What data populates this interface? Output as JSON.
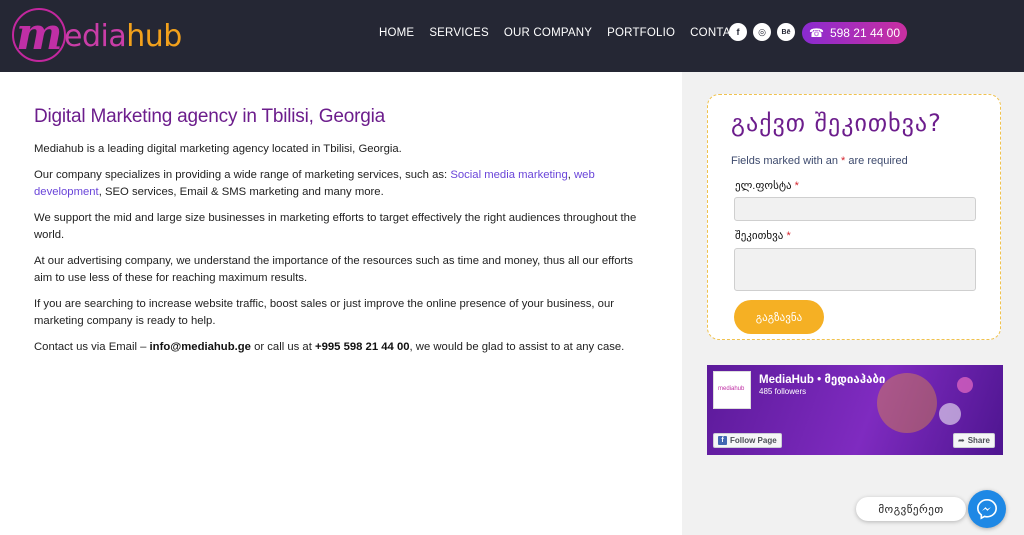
{
  "logo": {
    "m": "m",
    "media": "edia",
    "hub": "hub"
  },
  "nav": {
    "items": [
      "HOME",
      "SERVICES",
      "OUR COMPANY",
      "PORTFOLIO",
      "CONTACT"
    ]
  },
  "social": {
    "facebook": "f",
    "instagram": "◎",
    "behance": "Bē"
  },
  "phone_button": {
    "icon": "☎",
    "number": "598 21 44 00"
  },
  "main": {
    "title": "Digital Marketing agency in Tbilisi, Georgia",
    "p1": "Mediahub is a leading digital marketing agency located in Tbilisi, Georgia.",
    "p2_a": "Our company specializes in providing a wide range of marketing services, such as: ",
    "p2_link1": "Social media marketing",
    "p2_comma": ", ",
    "p2_link2": "web development",
    "p2_b": ", SEO services, Email & SMS marketing and many more.",
    "p3": "We support the mid and large size businesses in marketing efforts to target effectively the right audiences throughout the world.",
    "p4": "At our advertising company, we understand the importance of the resources such as time and money, thus all our efforts aim to use less of these  for reaching maximum results.",
    "p5": "If you are searching to increase website traffic, boost sales or just improve the online presence of your business, our marketing company is ready to help.",
    "p6_a": "Contact us via Email – ",
    "p6_email": "info@mediahub.ge",
    "p6_b": " or call us at ",
    "p6_phone": "+995 598 21 44 00",
    "p6_c": ", we would be glad to assist to at any case."
  },
  "form": {
    "title": "გაქვთ შეკითხვა?",
    "required_note": "Fields marked with an ",
    "required_star": "*",
    "required_note_end": " are required",
    "email_label": "ელ.ფოსტა",
    "question_label": "შეკითხვა",
    "submit": "გაგზავნა"
  },
  "fb_widget": {
    "name": "MediaHub • მედიაჰაბი",
    "followers": "485 followers",
    "thumb_text": "mediahub",
    "follow_label": "Follow Page",
    "share_label": "Share"
  },
  "chat": {
    "label": "მოგვწერეთ"
  },
  "colors": {
    "header_bg": "#252734",
    "title_purple": "#6c1d8c",
    "link": "#6a45d9",
    "accent_orange": "#f5b024",
    "phone_gradient": [
      "#8a2bd0",
      "#c92fa0"
    ]
  }
}
